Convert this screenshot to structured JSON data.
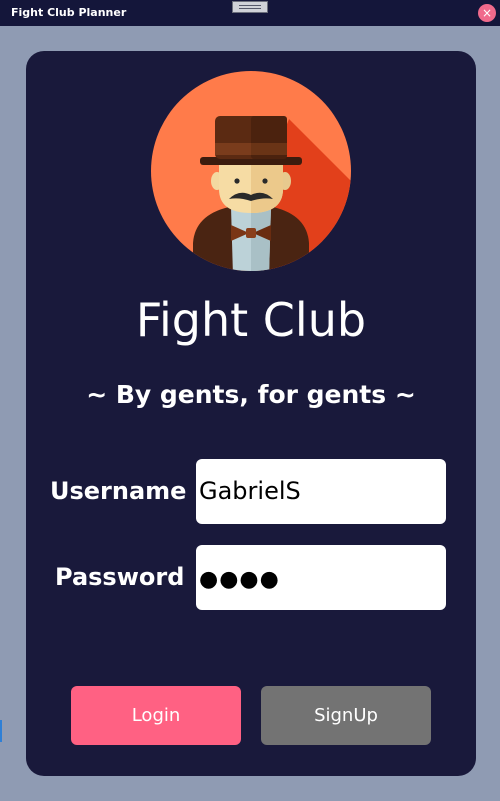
{
  "window": {
    "title": "Fight Club Planner",
    "close_glyph": "×",
    "icons": {
      "drag": "drag-handle-icon",
      "close": "close-icon"
    }
  },
  "login": {
    "avatar_icon": "gentleman-avatar-icon",
    "app_title": "Fight Club",
    "tagline": "~ By gents, for gents ~",
    "username_label": "Username",
    "username_value": "GabrielS",
    "password_label": "Password",
    "password_value": "●●●●",
    "login_button": "Login",
    "signup_button": "SignUp"
  },
  "colors": {
    "titlebar": "#14163a",
    "window_background": "#8f9bb3",
    "card": "#19193b",
    "login_button": "#ff6183",
    "signup_button": "#737373",
    "close_button": "#f06a8c"
  }
}
